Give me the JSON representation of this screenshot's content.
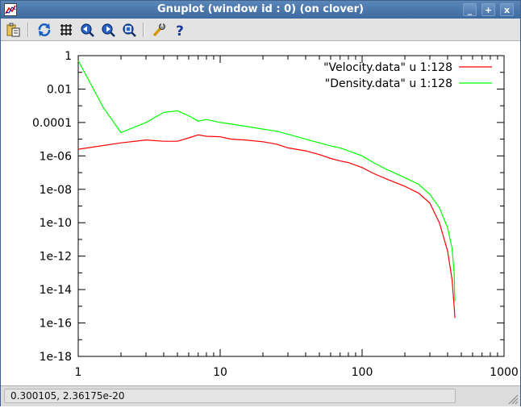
{
  "window": {
    "title": "Gnuplot (window id : 0) (on clover)",
    "buttons": {
      "minimize": "_",
      "maximize": "+",
      "close": "x"
    }
  },
  "toolbar": {
    "items": [
      {
        "icon": "copy-to-clipboard-icon"
      },
      {
        "icon": "replot-icon"
      },
      {
        "icon": "grid-icon"
      },
      {
        "icon": "previous-zoom-icon"
      },
      {
        "icon": "next-zoom-icon"
      },
      {
        "icon": "autoscale-icon"
      },
      {
        "icon": "settings-wrench-icon"
      },
      {
        "icon": "help-icon"
      }
    ]
  },
  "status": {
    "coordinates": "0.300105,  2.36175e-20"
  },
  "chart_data": {
    "type": "line",
    "x_scale": "log",
    "y_scale": "log",
    "xlim": [
      1,
      1000
    ],
    "ylim": [
      1e-18,
      1
    ],
    "x_ticks": [
      "1",
      "10",
      "100",
      "1000"
    ],
    "y_ticks": [
      "1",
      "0.01",
      "0.0001",
      "1e-06",
      "1e-08",
      "1e-10",
      "1e-12",
      "1e-14",
      "1e-16",
      "1e-18"
    ],
    "legend_placement": "top-right",
    "series": [
      {
        "name": "\"Velocity.data\" u 1:128",
        "color": "#ff0000",
        "points": [
          [
            1,
            2.5e-06
          ],
          [
            2,
            6e-06
          ],
          [
            3,
            9e-06
          ],
          [
            4,
            7.5e-06
          ],
          [
            5,
            7.5e-06
          ],
          [
            6,
            1.2e-05
          ],
          [
            7,
            1.8e-05
          ],
          [
            8,
            1.5e-05
          ],
          [
            10,
            1.4e-05
          ],
          [
            12,
            1e-05
          ],
          [
            15,
            9e-06
          ],
          [
            20,
            7e-06
          ],
          [
            25,
            5e-06
          ],
          [
            30,
            3e-06
          ],
          [
            40,
            2e-06
          ],
          [
            50,
            1.2e-06
          ],
          [
            60,
            7e-07
          ],
          [
            70,
            5e-07
          ],
          [
            80,
            4e-07
          ],
          [
            100,
            2e-07
          ],
          [
            120,
            9e-08
          ],
          [
            150,
            4e-08
          ],
          [
            200,
            1.5e-08
          ],
          [
            250,
            6e-09
          ],
          [
            300,
            1.5e-09
          ],
          [
            350,
            1e-10
          ],
          [
            400,
            2e-12
          ],
          [
            430,
            4e-14
          ],
          [
            445,
            1e-15
          ],
          [
            450,
            2e-16
          ]
        ]
      },
      {
        "name": "\"Density.data\" u 1:128",
        "color": "#00ff00",
        "points": [
          [
            1,
            0.5
          ],
          [
            1.5,
            0.0008
          ],
          [
            2,
            2.5e-05
          ],
          [
            3,
            0.0001
          ],
          [
            4,
            0.0004
          ],
          [
            5,
            0.0005
          ],
          [
            6,
            0.00025
          ],
          [
            7,
            0.00012
          ],
          [
            8,
            0.00015
          ],
          [
            10,
            0.0001
          ],
          [
            12,
            8e-05
          ],
          [
            15,
            6e-05
          ],
          [
            20,
            4e-05
          ],
          [
            25,
            3e-05
          ],
          [
            30,
            2e-05
          ],
          [
            40,
            1e-05
          ],
          [
            50,
            6e-06
          ],
          [
            60,
            4e-06
          ],
          [
            70,
            3e-06
          ],
          [
            80,
            2e-06
          ],
          [
            100,
            1e-06
          ],
          [
            120,
            4e-07
          ],
          [
            150,
            1.5e-07
          ],
          [
            200,
            5e-08
          ],
          [
            250,
            2e-08
          ],
          [
            300,
            5e-09
          ],
          [
            350,
            8e-10
          ],
          [
            400,
            5e-11
          ],
          [
            430,
            3e-12
          ],
          [
            445,
            1e-13
          ],
          [
            450,
            2e-15
          ]
        ]
      }
    ]
  }
}
